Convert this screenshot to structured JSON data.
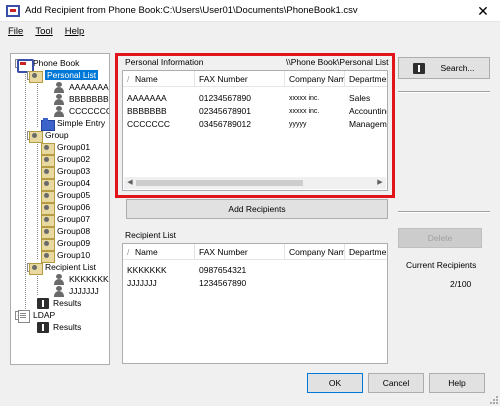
{
  "window": {
    "title": "Add Recipient from Phone Book:C:\\Users\\User01\\Documents\\PhoneBook1.csv",
    "close_glyph": "✕"
  },
  "menu": [
    "File",
    "Tool",
    "Help"
  ],
  "tree": {
    "root": "Phone Book",
    "personal_list": "Personal List",
    "personal_entries": [
      "AAAAAAA",
      "BBBBBBB",
      "CCCCCCC"
    ],
    "simple_entry": "Simple Entry",
    "group": "Group",
    "groups": [
      "Group01",
      "Group02",
      "Group03",
      "Group04",
      "Group05",
      "Group06",
      "Group07",
      "Group08",
      "Group09",
      "Group10"
    ],
    "recipient_list": "Recipient List",
    "recipient_entries": [
      "KKKKKKK",
      "JJJJJJJ"
    ],
    "results": "Results",
    "ldap": "LDAP",
    "ldap_results": "Results"
  },
  "personal_info": {
    "label": "Personal Information",
    "path": "\\\\Phone Book\\Personal List",
    "columns": [
      "Name",
      "FAX Number",
      "Company Name",
      "Department"
    ],
    "rows": [
      [
        "AAAAAAA",
        "01234567890",
        "xxxxx inc.",
        "Sales"
      ],
      [
        "BBBBBBB",
        "02345678901",
        "xxxxx inc.",
        "Accounting"
      ],
      [
        "CCCCCCC",
        "03456789012",
        "yyyyy",
        "Management"
      ]
    ]
  },
  "add_recipients_label": "Add Recipients",
  "recipient_list": {
    "label": "Recipient List",
    "columns": [
      "Name",
      "FAX Number",
      "Company Name",
      "Department"
    ],
    "rows": [
      [
        "KKKKKKK",
        "0987654321",
        "",
        ""
      ],
      [
        "JJJJJJJ",
        "1234567890",
        "",
        ""
      ]
    ]
  },
  "search_label": "Search...",
  "delete_label": "Delete",
  "current_recipients_label": "Current Recipients",
  "current_recipients_value": "2/100",
  "ok_label": "OK",
  "cancel_label": "Cancel",
  "help_label": "Help",
  "colors": {
    "highlight": "#e0141a",
    "selection": "#0078d7"
  }
}
